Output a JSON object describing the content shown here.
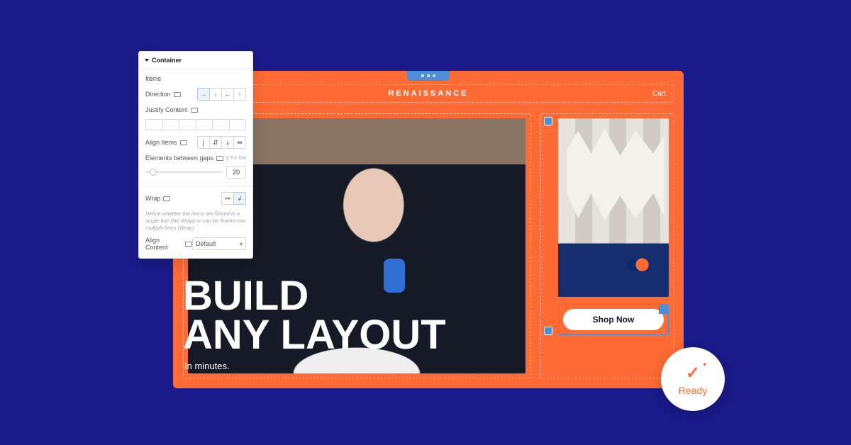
{
  "panel": {
    "title": "Container",
    "items_heading": "Items",
    "direction_label": "Direction",
    "justify_label": "Justify Content",
    "align_items_label": "Align Items",
    "gaps_label": "Elements between gaps",
    "gaps_px_unit": "PX",
    "gaps_em_unit": "EM",
    "gaps_value": "20",
    "wrap_label": "Wrap",
    "wrap_hint": "Define whether the items are forced in a single line (No Wrap) or can be flowed into multiple lines (Wrap)",
    "align_content_label": "Align Content",
    "align_content_value": "Default"
  },
  "canvas": {
    "brand": "RENAISSANCE",
    "cart": "Cart",
    "headline_line1": "BUILD",
    "headline_line2": "ANY LAYOUT",
    "subtitle": "In minutes.",
    "shop_button": "Shop Now"
  },
  "badge": {
    "label": "Ready"
  }
}
